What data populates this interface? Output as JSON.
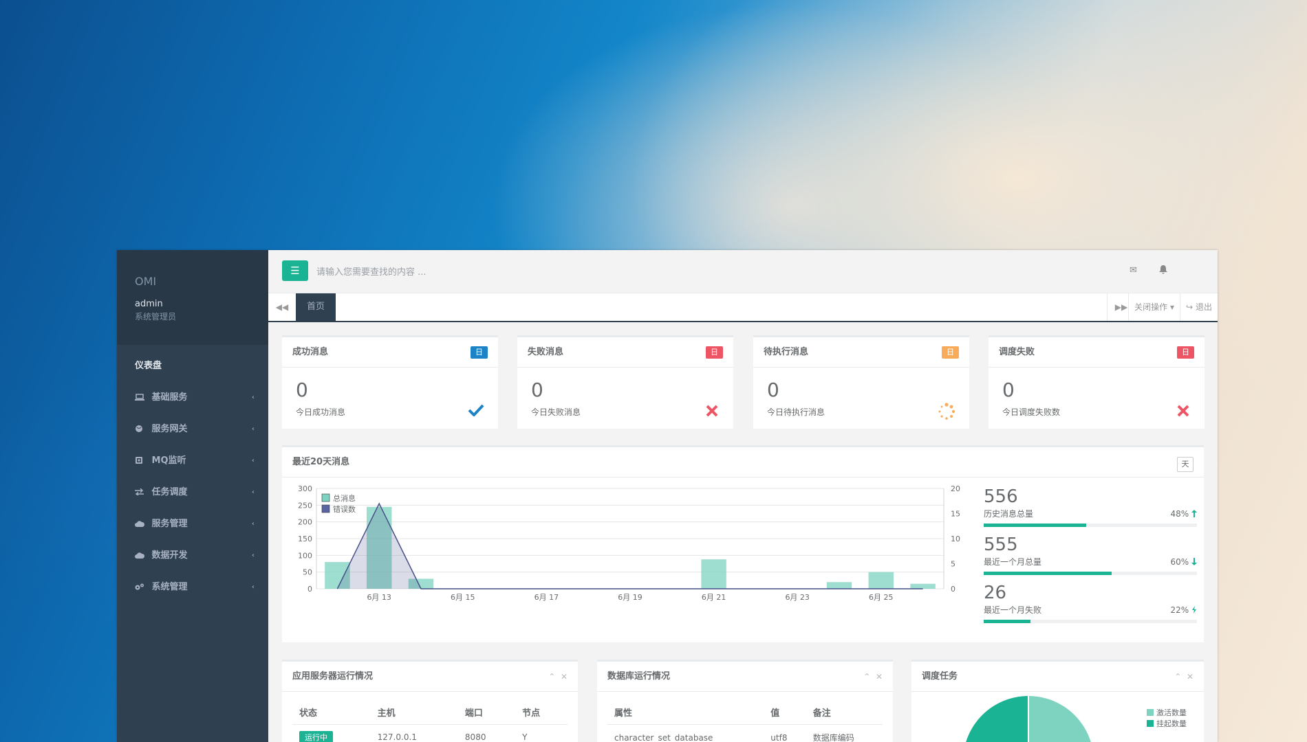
{
  "sidebar": {
    "brand": "OMI",
    "user_name": "admin",
    "user_role": "系统管理员",
    "items": [
      {
        "label": "仪表盘",
        "icon": ""
      },
      {
        "label": "基础服务",
        "icon": "laptop-icon"
      },
      {
        "label": "服务网关",
        "icon": "globe-icon"
      },
      {
        "label": "MQ监听",
        "icon": "square-icon"
      },
      {
        "label": "任务调度",
        "icon": "exchange-icon"
      },
      {
        "label": "服务管理",
        "icon": "cloud-icon"
      },
      {
        "label": "数据开发",
        "icon": "cloud-icon"
      },
      {
        "label": "系统管理",
        "icon": "cogs-icon"
      }
    ]
  },
  "topbar": {
    "search_placeholder": "请输入您需要查找的内容 ..."
  },
  "tabs": {
    "active": "首页",
    "close_ops": "关闭操作",
    "logout": "退出"
  },
  "stats": [
    {
      "title": "成功消息",
      "badge": "日",
      "badge_color": "#1c84c6",
      "value": "0",
      "sub": "今日成功消息",
      "icon": "check-icon",
      "icon_color": "#1c84c6"
    },
    {
      "title": "失败消息",
      "badge": "日",
      "badge_color": "#ed5565",
      "value": "0",
      "sub": "今日失败消息",
      "icon": "close-icon",
      "icon_color": "#ed5565"
    },
    {
      "title": "待执行消息",
      "badge": "日",
      "badge_color": "#f8ac59",
      "value": "0",
      "sub": "今日待执行消息",
      "icon": "spinner-icon",
      "icon_color": "#f8ac59"
    },
    {
      "title": "调度失败",
      "badge": "日",
      "badge_color": "#ed5565",
      "value": "0",
      "sub": "今日调度失败数",
      "icon": "close-icon",
      "icon_color": "#ed5565"
    }
  ],
  "chart_box": {
    "title": "最近20天消息",
    "day_button": "天"
  },
  "kpis": [
    {
      "value": "556",
      "label": "历史消息总量",
      "percent": "48%",
      "fill": 0.48,
      "trend": "up-arrow-icon"
    },
    {
      "value": "555",
      "label": "最近一个月总量",
      "percent": "60%",
      "fill": 0.6,
      "trend": "down-arrow-icon"
    },
    {
      "value": "26",
      "label": "最近一个月失败",
      "percent": "22%",
      "fill": 0.22,
      "trend": "bolt-icon"
    }
  ],
  "chart_data": {
    "type": "bar",
    "x": [
      "6月 12",
      "6月 13",
      "6月 14",
      "6月 15",
      "6月 16",
      "6月 17",
      "6月 18",
      "6月 19",
      "6月 20",
      "6月 21",
      "6月 22",
      "6月 23",
      "6月 24",
      "6月 25",
      "6月 26"
    ],
    "x_tick_labels": [
      "6月 13",
      "6月 15",
      "6月 17",
      "6月 19",
      "6月 21",
      "6月 23",
      "6月 25"
    ],
    "series": [
      {
        "name": "总消息",
        "type": "bar",
        "axis": "left",
        "color": "#7dd3c0",
        "values": [
          80,
          245,
          30,
          0,
          0,
          0,
          0,
          0,
          0,
          88,
          0,
          0,
          20,
          50,
          15
        ]
      },
      {
        "name": "错误数",
        "type": "area",
        "axis": "right",
        "color": "#464f88",
        "values": [
          0,
          17,
          0,
          0,
          0,
          0,
          0,
          0,
          0,
          0,
          0,
          0,
          0,
          0,
          0
        ]
      }
    ],
    "ylim_left": [
      0,
      300
    ],
    "yticks_left": [
      0,
      50,
      100,
      150,
      200,
      250,
      300
    ],
    "ylim_right": [
      0,
      20
    ],
    "yticks_right": [
      0,
      5,
      10,
      15,
      20
    ],
    "legend": "top-left",
    "grid": true
  },
  "panels": {
    "servers": {
      "title": "应用服务器运行情况",
      "headers": [
        "状态",
        "主机",
        "端口",
        "节点"
      ],
      "rows": [
        [
          "运行中",
          "127.0.0.1",
          "8080",
          "Y"
        ]
      ]
    },
    "database": {
      "title": "数据库运行情况",
      "headers": [
        "属性",
        "值",
        "备注"
      ],
      "rows": [
        [
          "character_set_database",
          "utf8",
          "数据库编码"
        ]
      ]
    },
    "schedule": {
      "title": "调度任务",
      "legend": [
        {
          "label": "激活数量",
          "color": "#7dd3c0"
        },
        {
          "label": "挂起数量",
          "color": "#1ab394"
        }
      ]
    }
  }
}
